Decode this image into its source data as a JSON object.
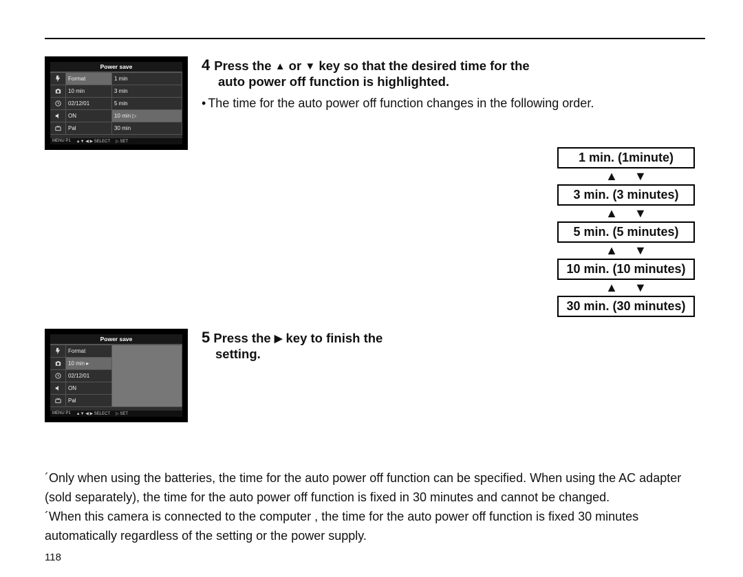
{
  "screen1": {
    "title": "Power save",
    "rows": [
      {
        "left": "Format",
        "right": "1 min"
      },
      {
        "left": "10 min",
        "right": "3 min"
      },
      {
        "left": "02/12/01",
        "right": "5 min"
      },
      {
        "left": "ON",
        "right": "10 min",
        "hi": true,
        "arrow": true
      },
      {
        "left": "Pal",
        "right": "30 min"
      }
    ],
    "footer": [
      "MENU P1",
      "▲▼ ◀ ▶ SELECT",
      "▷ SET"
    ]
  },
  "screen2": {
    "title": "Power save",
    "rows": [
      {
        "left": "Format"
      },
      {
        "left": "10 min",
        "hi": true,
        "arrow": true
      },
      {
        "left": "02/12/01"
      },
      {
        "left": "ON"
      },
      {
        "left": "Pal"
      }
    ],
    "footer": [
      "MENU P1",
      "▲▼ ◀ ▶ SELECT",
      "▷ SET"
    ]
  },
  "step4": {
    "num": "4",
    "line1a": "Press the ",
    "line1b": " or ",
    "line1c": " key so that the desired time for the",
    "line2": "auto power off function is highlighted.",
    "note": "The time for the auto power off function changes in the following order."
  },
  "sequence": [
    "1 min. (1minute)",
    "3 min. (3 minutes)",
    "5 min. (5 minutes)",
    "10 min. (10 minutes)",
    "30 min. (30 minutes)"
  ],
  "step5": {
    "num": "5",
    "a": "Press the ",
    "b": " key to finish the",
    "c": "setting."
  },
  "notes": {
    "n1": "´Only when using the batteries, the time for the auto power off function can be specified. When using the AC adapter (sold separately), the time for the auto power off function is fixed in 30 minutes and cannot be changed.",
    "n2": "´When this camera is connected to the computer , the time for the auto power off function is fixed 30 minutes automatically regardless of the setting or the power supply."
  },
  "pagenum": "118"
}
